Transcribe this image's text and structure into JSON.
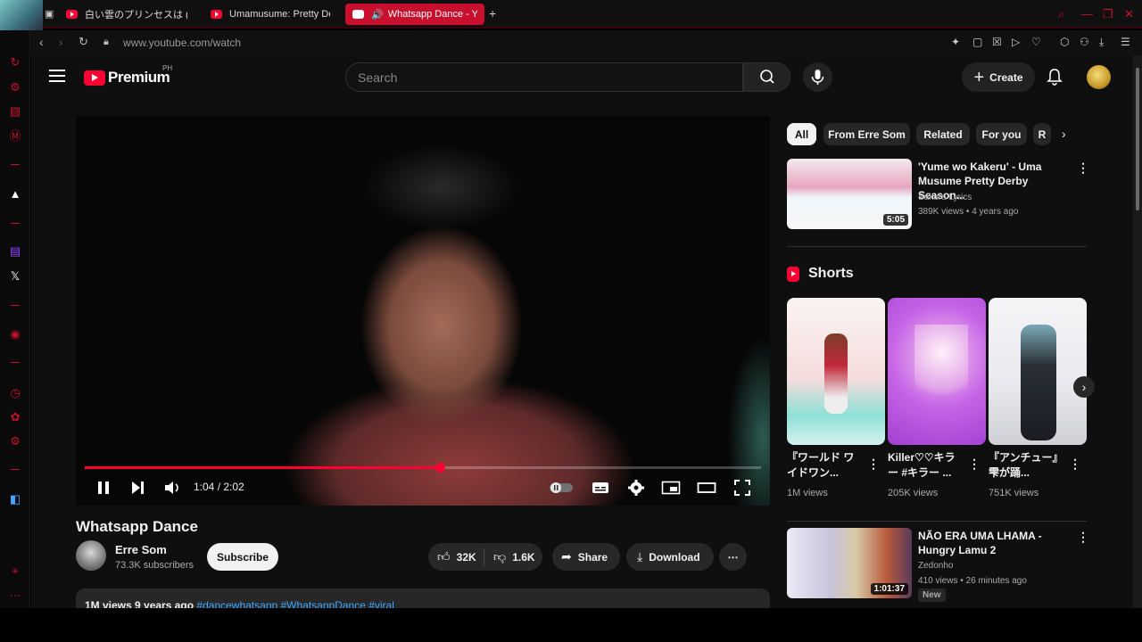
{
  "browser": {
    "tabs": [
      {
        "label": "白い雲のプリンセスは (feat. 花"
      },
      {
        "label": "Umamusume: Pretty Derby"
      },
      {
        "label": "Whatsapp Dance - You"
      }
    ],
    "new_tab": "+",
    "url": "www.youtube.com/watch",
    "accent_color": "#c8102e"
  },
  "youtube": {
    "logo_word": "Premium",
    "country_code": "PH",
    "search_placeholder": "Search",
    "create_label": "Create"
  },
  "player": {
    "current_time": "1:04",
    "duration": "2:02",
    "time_display": "1:04 / 2:02",
    "progress": 0.525
  },
  "video": {
    "title": "Whatsapp Dance",
    "channel": "Erre Som",
    "subscribers": "73.3K subscribers",
    "subscribe_label": "Subscribe",
    "likes": "32K",
    "dislikes": "1.6K",
    "share_label": "Share",
    "download_label": "Download",
    "views_date": "1M views  9 years ago",
    "tags": "#dancewhatsapp #WhatsappDance #viral"
  },
  "sidebar": {
    "chips": [
      "All",
      "From Erre Som",
      "Related",
      "For you",
      "R"
    ],
    "rec1": {
      "title": "'Yume wo Kakeru' - Uma Musume Pretty Derby Season...",
      "channel": "Sakura Lyrics",
      "meta": "389K views • 4 years ago",
      "duration": "5:05"
    },
    "shorts_heading": "Shorts",
    "shorts": [
      {
        "title": "『ワールド ワイドワン...",
        "views": "1M views"
      },
      {
        "title": "Killer♡♡キラー #キラー ...",
        "views": "205K views"
      },
      {
        "title": "『アンチュー』雫が踊...",
        "views": "751K views"
      }
    ],
    "rec2": {
      "title": "NÃO ERA UMA LHAMA - Hungry Lamu 2",
      "channel": "Zedonho",
      "meta": "410 views • 26 minutes ago",
      "duration": "1:01:37",
      "badge": "New"
    }
  }
}
